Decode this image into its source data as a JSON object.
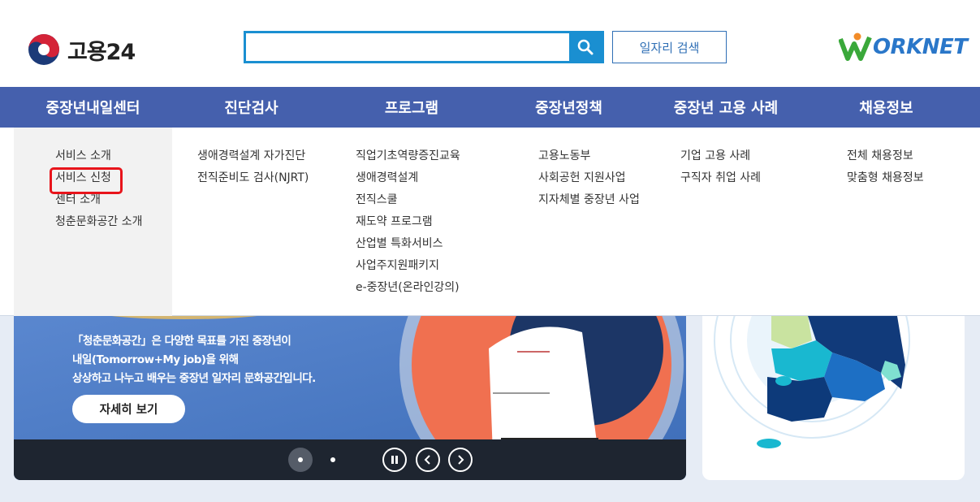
{
  "header": {
    "logo_text": "고용24",
    "search": {
      "value": "",
      "placeholder": ""
    },
    "job_search_label": "일자리 검색",
    "worknet_text": "ORKNET"
  },
  "nav": {
    "items": [
      {
        "label": "중장년내일센터"
      },
      {
        "label": "진단검사"
      },
      {
        "label": "프로그램"
      },
      {
        "label": "중장년정책"
      },
      {
        "label": "중장년 고용 사례"
      },
      {
        "label": "채용정보"
      }
    ]
  },
  "dropdown": {
    "col1": [
      "서비스 소개",
      "서비스 신청",
      "센터 소개",
      "청춘문화공간 소개"
    ],
    "col2": [
      "생애경력설계 자가진단",
      "전직준비도 검사(NJRT)"
    ],
    "col3": [
      "직업기초역량증진교육",
      "생애경력설계",
      "전직스쿨",
      "재도약 프로그램",
      "산업별 특화서비스",
      "사업주지원패키지",
      "e-중장년(온라인강의)"
    ],
    "col4": [
      "고용노동부",
      "사회공헌 지원사업",
      "지자체별 중장년 사업"
    ],
    "col5": [
      "기업 고용 사례",
      "구직자 취업 사례"
    ],
    "col6": [
      "전체 채용정보",
      "맞춤형 채용정보"
    ]
  },
  "banner": {
    "line1": "「청춘문화공간」은 다양한 목표를 가진 중장년이",
    "line2": "내일(Tomorrow+My job)을 위해",
    "line3": "상상하고 나누고 배우는 중장년 일자리 문화공간입니다.",
    "detail_button": "자세히 보기"
  },
  "colors": {
    "nav_bg": "#4560ad",
    "accent": "#1a8fd1",
    "highlight": "#e8141b"
  }
}
